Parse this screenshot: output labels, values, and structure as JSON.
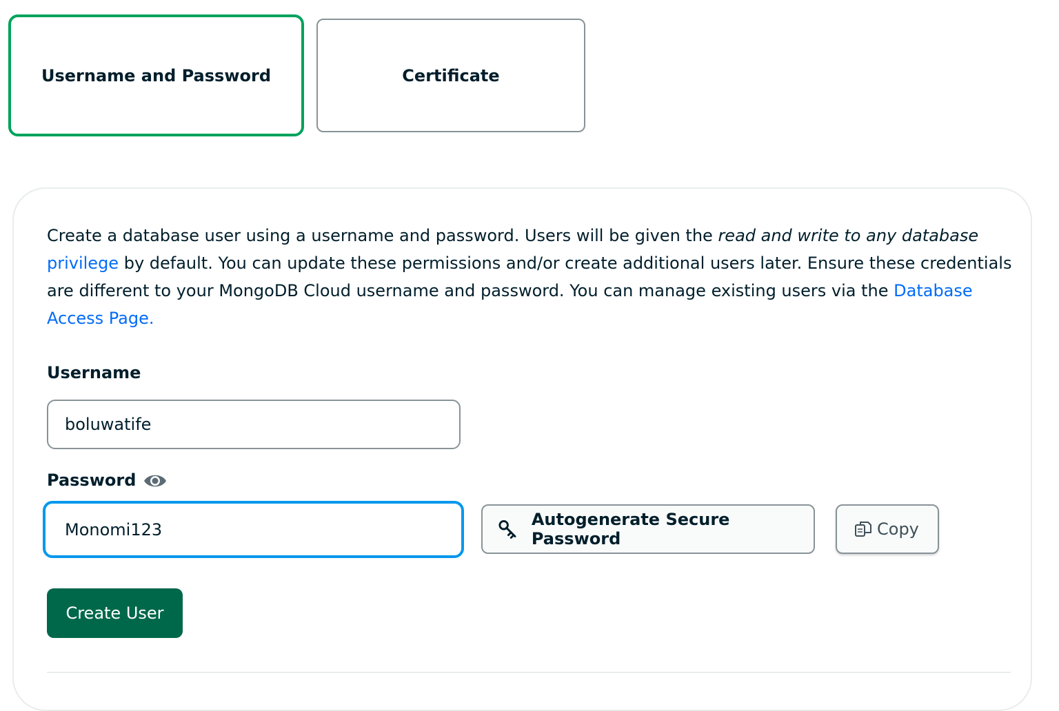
{
  "auth_methods": {
    "username_password": "Username and Password",
    "certificate": "Certificate"
  },
  "description": {
    "part1": "Create a database user using a username and password. Users will be given the ",
    "italic": "read and write to any database",
    "link_privilege": "privilege",
    "part2": " by default. You can update these permissions and/or create additional users later. Ensure these credentials are different to your MongoDB Cloud username and password. You can manage existing users via the ",
    "link_access_page": "Database Access Page."
  },
  "username": {
    "label": "Username",
    "value": "boluwatife"
  },
  "password": {
    "label": "Password",
    "value": "Monomi123"
  },
  "buttons": {
    "autogenerate": "Autogenerate Secure Password",
    "copy": "Copy",
    "create_user": "Create User"
  },
  "icons": {
    "eye": "eye-icon",
    "key": "key-icon",
    "copy": "copy-icon"
  },
  "colors": {
    "selected_border": "#00a35c",
    "focus_border": "#0498ec",
    "primary_button": "#00684a",
    "link": "#016bf8"
  }
}
